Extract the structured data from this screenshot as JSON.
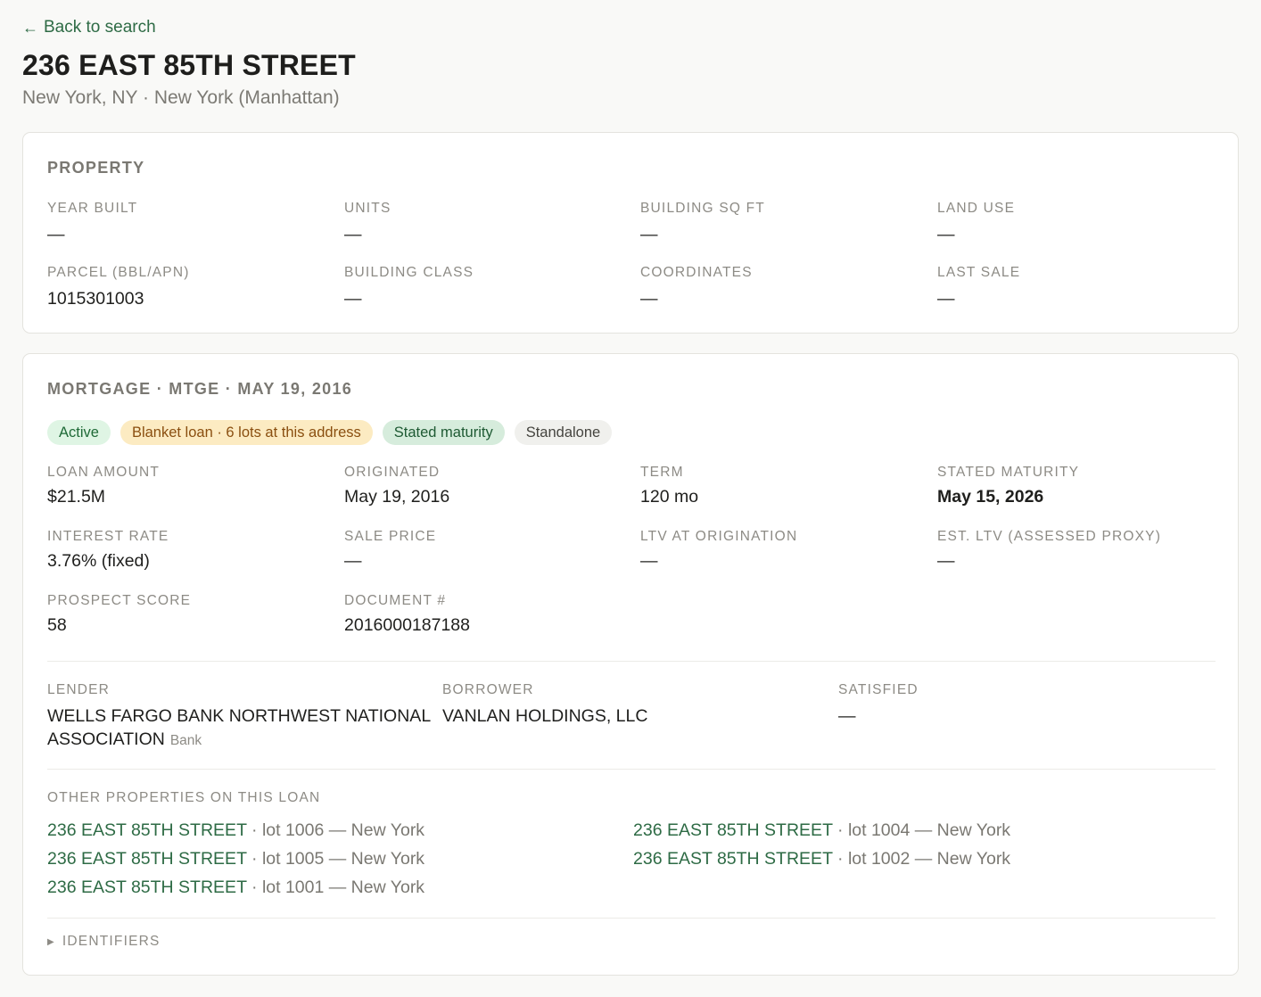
{
  "nav": {
    "back_label": "Back to search",
    "back_icon": "arrow-left-icon"
  },
  "header": {
    "title": "236 EAST 85TH STREET",
    "subtitle": "New York, NY · New York (Manhattan)"
  },
  "property": {
    "section_title": "PROPERTY",
    "fields": [
      {
        "label": "YEAR BUILT",
        "value": "—"
      },
      {
        "label": "UNITS",
        "value": "—"
      },
      {
        "label": "BUILDING SQ FT",
        "value": "—"
      },
      {
        "label": "LAND USE",
        "value": "—"
      },
      {
        "label": "PARCEL (BBL/APN)",
        "value": "1015301003"
      },
      {
        "label": "BUILDING CLASS",
        "value": "—"
      },
      {
        "label": "COORDINATES",
        "value": "—"
      },
      {
        "label": "LAST SALE",
        "value": "—"
      }
    ]
  },
  "mortgage": {
    "section_title": "MORTGAGE · MTGE · MAY 19, 2016",
    "badges": [
      {
        "label": "Active",
        "color": "#dff5e4"
      },
      {
        "label": "Blanket loan · 6 lots at this address",
        "color": "#fcebc2"
      },
      {
        "label": "Stated maturity",
        "color": "#d6ecdc"
      },
      {
        "label": "Standalone",
        "color": "#f0f0ed"
      }
    ],
    "fields": [
      {
        "label": "LOAN AMOUNT",
        "value": "$21.5M"
      },
      {
        "label": "ORIGINATED",
        "value": "May 19, 2016"
      },
      {
        "label": "TERM",
        "value": "120 mo"
      },
      {
        "label": "STATED MATURITY",
        "value": "May 15, 2026"
      },
      {
        "label": "INTEREST RATE",
        "value": "3.76% (fixed)"
      },
      {
        "label": "SALE PRICE",
        "value": "—"
      },
      {
        "label": "LTV AT ORIGINATION",
        "value": "—"
      },
      {
        "label": "EST. LTV (ASSESSED PROXY)",
        "value": "—"
      },
      {
        "label": "PROSPECT SCORE",
        "value": "58"
      },
      {
        "label": "DOCUMENT #",
        "value": "2016000187188"
      }
    ],
    "lender": {
      "label": "LENDER",
      "line1": "WELLS FARGO BANK NORTHWEST NATIONAL",
      "line2": "ASSOCIATION",
      "type": "Bank"
    },
    "borrower": {
      "label": "BORROWER",
      "value": "VANLAN HOLDINGS, LLC"
    },
    "satisfied": {
      "label": "SATISFIED",
      "value": "—"
    },
    "other_properties": {
      "label": "OTHER PROPERTIES ON THIS LOAN",
      "items": [
        {
          "address": "236 EAST 85TH STREET",
          "detail": " · lot 1006 — New York"
        },
        {
          "address": "236 EAST 85TH STREET",
          "detail": " · lot 1004 — New York"
        },
        {
          "address": "236 EAST 85TH STREET",
          "detail": " · lot 1005 — New York"
        },
        {
          "address": "236 EAST 85TH STREET",
          "detail": " · lot 1002 — New York"
        },
        {
          "address": "236 EAST 85TH STREET",
          "detail": " · lot 1001 — New York"
        }
      ]
    },
    "identifiers_label": "IDENTIFIERS"
  },
  "colors": {
    "accent_green": "#2e6b45",
    "background": "#f9f9f7",
    "muted_text": "#8d8b85"
  }
}
